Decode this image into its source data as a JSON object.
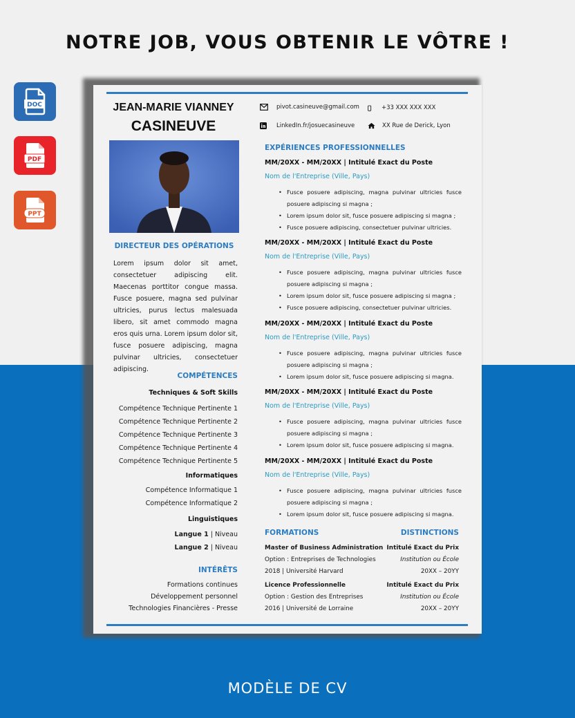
{
  "headline": "NOTRE JOB, VOUS OBTENIR LE VÔTRE !",
  "footer_title": "MODÈLE DE CV",
  "formats": {
    "doc": "DOC",
    "pdf": "PDF",
    "ppt": "PPT"
  },
  "colors": {
    "accent": "#2b7cc3",
    "band": "#0a6fbd",
    "company": "#2b9ac0"
  },
  "cv": {
    "first_names": "JEAN-MARIE VIANNEY",
    "last_name": "CASINEUVE",
    "role": "DIRECTEUR DES OPÉRATIONS",
    "profile": "Lorem ipsum dolor sit amet, consectetuer adipiscing elit. Maecenas porttitor congue massa. Fusce posuere, magna sed pulvinar ultricies, purus lectus malesuada libero, sit amet commodo magna eros quis urna. Lorem ipsum dolor sit, fusce posuere adipiscing, magna pulvinar ultricies, consectetuer adipiscing.",
    "contact": {
      "email": "pivot.casineuve@gmail.com",
      "phone": "+33 XXX XXX XXX",
      "linkedin": "LinkedIn.fr/josuecasineuve",
      "address": "XX Rue de Derick, Lyon"
    },
    "skills": {
      "heading": "COMPÉTENCES",
      "technical_heading": "Techniques & Soft Skills",
      "technical": [
        "Compétence Technique Pertinente 1",
        "Compétence Technique Pertinente 2",
        "Compétence Technique Pertinente 3",
        "Compétence Technique Pertinente 4",
        "Compétence Technique Pertinente 5"
      ],
      "it_heading": "Informatiques",
      "it": [
        "Compétence Informatique 1",
        "Compétence Informatique 2"
      ],
      "lang_heading": "Linguistiques",
      "languages": [
        {
          "name": "Langue 1",
          "level": "Niveau"
        },
        {
          "name": "Langue 2",
          "level": "Niveau"
        }
      ]
    },
    "interests": {
      "heading": "INTÉRÊTS",
      "items": [
        "Formations continues",
        "Développement personnel",
        "Technologies Financières - Presse"
      ]
    },
    "experience_heading": "EXPÉRIENCES PROFESSIONNELLES",
    "experiences": [
      {
        "dates": "MM/20XX - MM/20XX |",
        "title": "Intitulé Exact du Poste",
        "company": "Nom de l'Entreprise (Ville, Pays)",
        "bullets": [
          "Fusce posuere adipiscing, magna pulvinar ultricies fusce posuere adipiscing si magna ;",
          "Lorem ipsum dolor sit, fusce posuere adipiscing si magna ;",
          "Fusce posuere adipiscing, consectetuer pulvinar ultricies."
        ]
      },
      {
        "dates": "MM/20XX - MM/20XX |",
        "title": "Intitulé Exact du Poste",
        "company": "Nom de l'Entreprise (Ville, Pays)",
        "bullets": [
          "Fusce posuere adipiscing, magna pulvinar ultricies fusce posuere adipiscing si magna ;",
          "Lorem ipsum dolor sit, fusce posuere adipiscing si magna ;",
          "Fusce posuere adipiscing, consectetuer pulvinar ultricies."
        ]
      },
      {
        "dates": "MM/20XX - MM/20XX |",
        "title": "Intitulé Exact du Poste",
        "company": "Nom de l'Entreprise (Ville, Pays)",
        "bullets": [
          "Fusce posuere adipiscing, magna pulvinar ultricies fusce posuere adipiscing si magna ;",
          "Lorem ipsum dolor sit, fusce posuere adipiscing si magna."
        ]
      },
      {
        "dates": "MM/20XX - MM/20XX |",
        "title": "Intitulé Exact du Poste",
        "company": "Nom de l'Entreprise (Ville, Pays)",
        "bullets": [
          "Fusce posuere adipiscing, magna pulvinar ultricies fusce posuere adipiscing si magna ;",
          "Lorem ipsum dolor sit, fusce posuere adipiscing si magna."
        ]
      },
      {
        "dates": "MM/20XX - MM/20XX |",
        "title": "Intitulé Exact du Poste",
        "company": "Nom de l'Entreprise (Ville, Pays)",
        "bullets": [
          "Fusce posuere adipiscing, magna pulvinar ultricies fusce posuere adipiscing si magna ;",
          "Lorem ipsum dolor sit, fusce posuere adipiscing si magna."
        ]
      }
    ],
    "education_heading": "FORMATIONS",
    "education": [
      {
        "degree": "Master of Business Administration",
        "option": "Option : Entreprises de Technologies",
        "year_school": "2018 | Université Harvard"
      },
      {
        "degree": "Licence Professionnelle",
        "option": "Option : Gestion des Entreprises",
        "year_school": "2016 | Université de Lorraine"
      }
    ],
    "distinctions_heading": "DISTINCTIONS",
    "distinctions": [
      {
        "title": "Intitulé Exact du Prix",
        "institution": "Institution ou École",
        "years": "20XX – 20YY"
      },
      {
        "title": "Intitulé Exact du Prix",
        "institution": "Institution ou École",
        "years": "20XX – 20YY"
      }
    ]
  }
}
